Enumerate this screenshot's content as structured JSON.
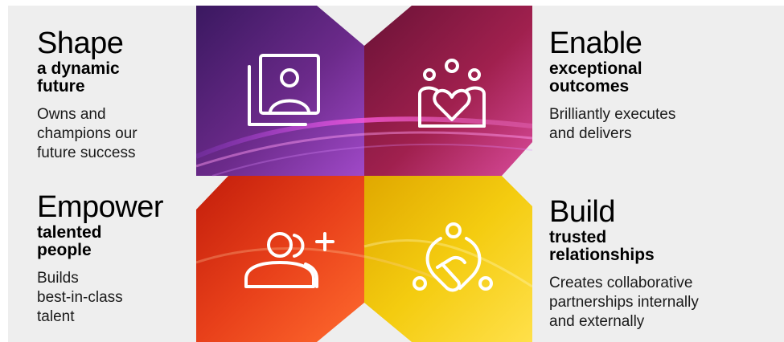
{
  "panels": {
    "shape": {
      "heading": "Shape",
      "subheading_line1": "a dynamic",
      "subheading_line2": "future",
      "desc_line1": "Owns and",
      "desc_line2": "champions our",
      "desc_line3": "future success"
    },
    "enable": {
      "heading": "Enable",
      "subheading_line1": "exceptional",
      "subheading_line2": "outcomes",
      "desc_line1": "Brilliantly executes",
      "desc_line2": "and delivers"
    },
    "empower": {
      "heading": "Empower",
      "subheading_line1": "talented",
      "subheading_line2": "people",
      "desc_line1": "Builds",
      "desc_line2": "best-in-class",
      "desc_line3": "talent"
    },
    "build": {
      "heading": "Build",
      "subheading_line1": "trusted",
      "subheading_line2": "relationships",
      "desc_line1": "Creates collaborative",
      "desc_line2": "partnerships internally",
      "desc_line3": "and externally"
    }
  },
  "tiles": [
    {
      "name": "portrait-icon",
      "colors": [
        "#3a1860",
        "#6b2a8a",
        "#a049c8"
      ]
    },
    {
      "name": "team-heart-icon",
      "colors": [
        "#6a1236",
        "#a0204e",
        "#d84a9a"
      ]
    },
    {
      "name": "add-person-icon",
      "colors": [
        "#c21d0b",
        "#e8401a",
        "#ff6a2e"
      ]
    },
    {
      "name": "handshake-network-icon",
      "colors": [
        "#e0a800",
        "#f4cc10",
        "#ffe04a"
      ]
    }
  ],
  "colors": {
    "background": "#eeeeee",
    "icon_stroke": "#ffffff"
  }
}
